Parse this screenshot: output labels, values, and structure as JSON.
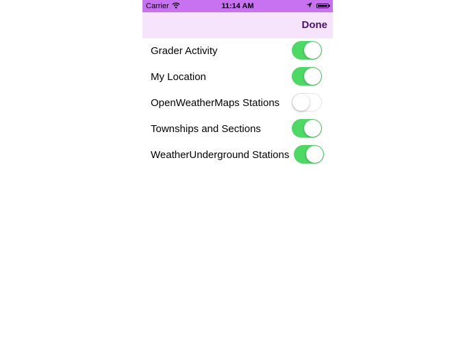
{
  "status_bar": {
    "carrier": "Carrier",
    "time": "11:14 AM",
    "wifi_icon": "wifi-icon",
    "location_icon": "location-arrow-icon",
    "battery_icon": "battery-icon"
  },
  "nav_bar": {
    "done_label": "Done"
  },
  "layers": [
    {
      "label": "Grader Activity",
      "on": true
    },
    {
      "label": "My Location",
      "on": true
    },
    {
      "label": "OpenWeatherMaps Stations",
      "on": false
    },
    {
      "label": "Townships and Sections",
      "on": true
    },
    {
      "label": "WeatherUnderground Stations",
      "on": true
    }
  ],
  "colors": {
    "status_bar": "#c872f2",
    "nav_bar": "#f5e4fb",
    "done_text": "#4a1370",
    "toggle_on": "#4cd964"
  }
}
